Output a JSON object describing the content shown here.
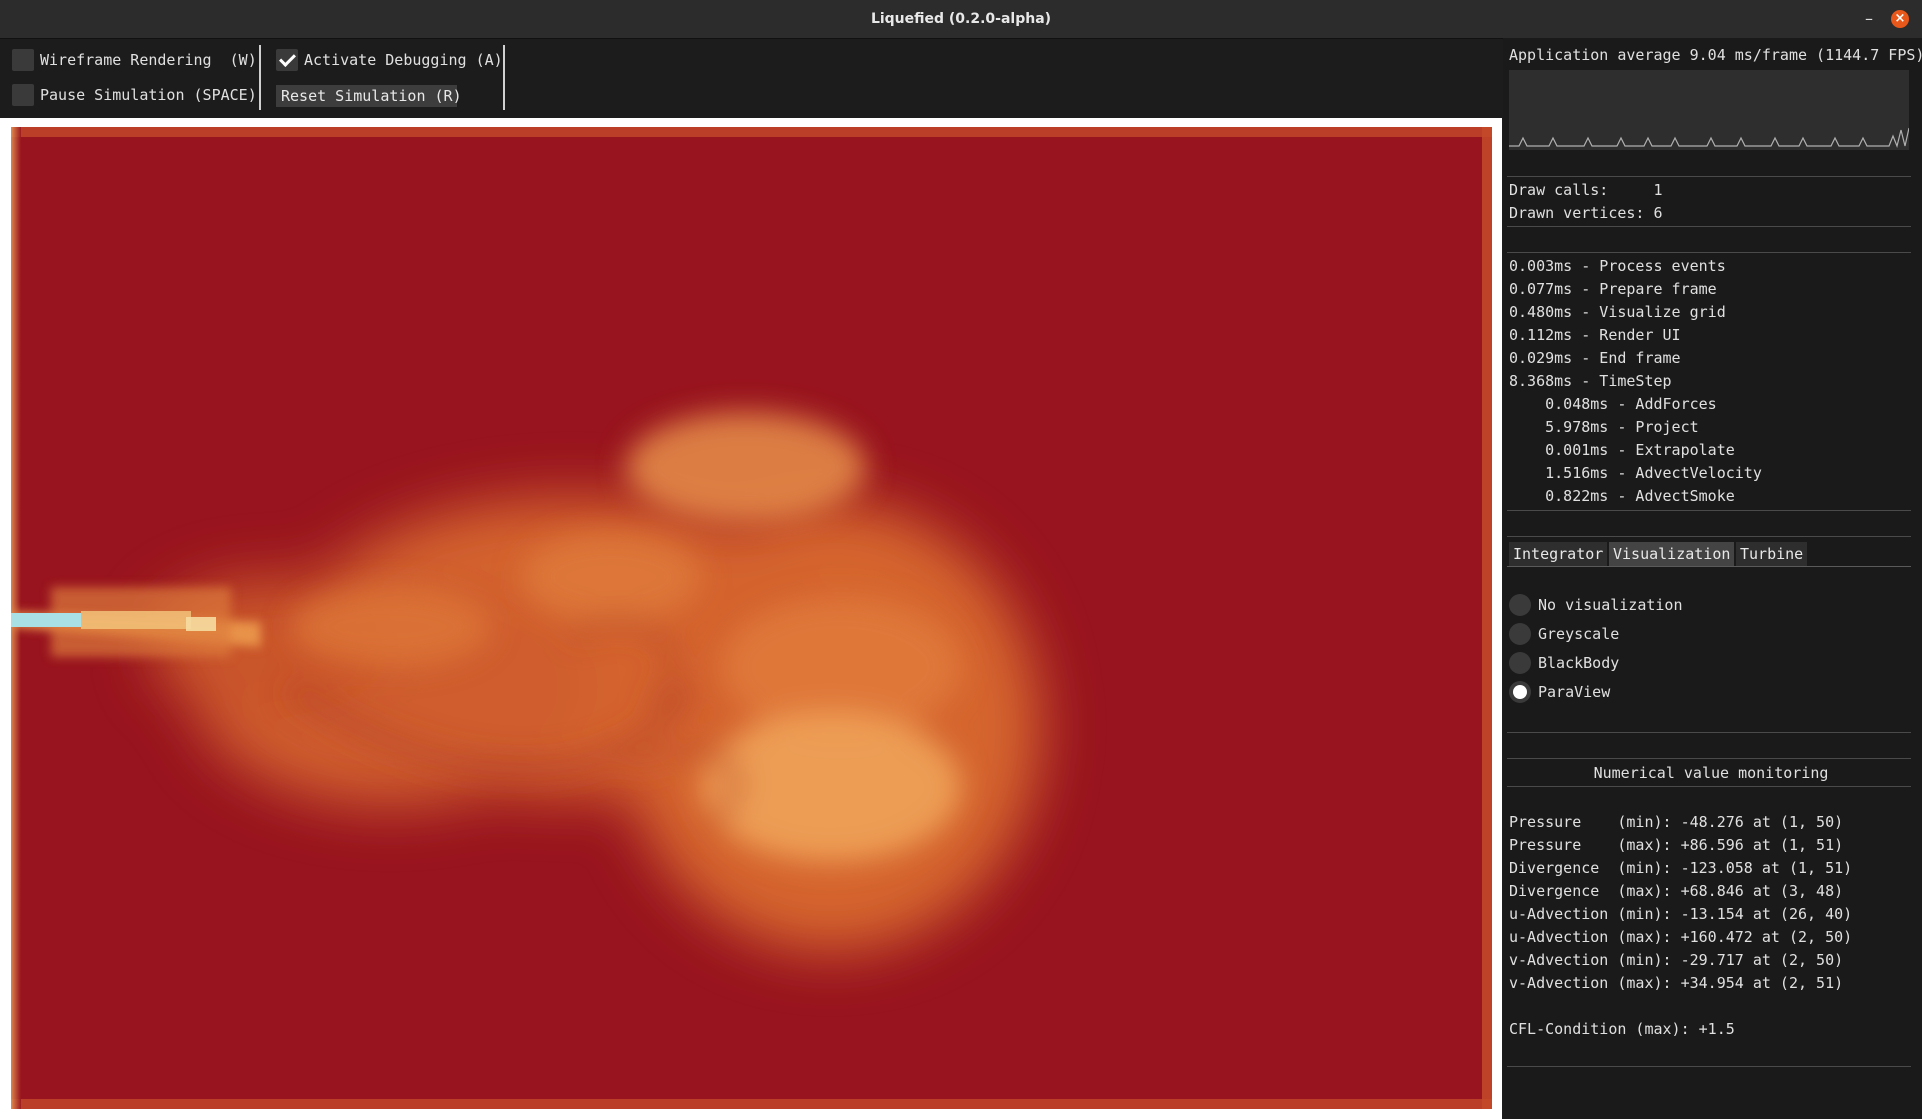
{
  "window": {
    "title": "Liquefied (0.2.0-alpha)",
    "minimize_glyph": "–",
    "close_glyph": "×"
  },
  "toolbar": {
    "wireframe_label": "Wireframe Rendering  (W)",
    "wireframe_checked": false,
    "pause_label": "Pause Simulation (SPACE)",
    "pause_checked": false,
    "debug_label": "Activate Debugging (A)",
    "debug_checked": true,
    "reset_label": "Reset Simulation (R)"
  },
  "stats": {
    "app_average": "Application average 9.04 ms/frame (1144.7 FPS)",
    "draw_calls": "Draw calls:     1",
    "drawn_vertices": "Drawn vertices: 6"
  },
  "timings": [
    "0.003ms - Process events",
    "0.077ms - Prepare frame",
    "0.480ms - Visualize grid",
    "0.112ms - Render UI",
    "0.029ms - End frame",
    "8.368ms - TimeStep",
    "    0.048ms - AddForces",
    "    5.978ms - Project",
    "    0.001ms - Extrapolate",
    "    1.516ms - AdvectVelocity",
    "    0.822ms - AdvectSmoke"
  ],
  "tabs": [
    {
      "label": "Integrator",
      "active": false
    },
    {
      "label": "Visualization",
      "active": true
    },
    {
      "label": "Turbine",
      "active": false
    }
  ],
  "visualization_options": [
    {
      "label": "No visualization",
      "selected": false
    },
    {
      "label": "Greyscale",
      "selected": false
    },
    {
      "label": "BlackBody",
      "selected": false
    },
    {
      "label": "ParaView",
      "selected": true
    }
  ],
  "monitoring": {
    "title": "Numerical value monitoring",
    "rows": [
      "Pressure    (min): -48.276 at (1, 50)",
      "Pressure    (max): +86.596 at (1, 51)",
      "Divergence  (min): -123.058 at (1, 51)",
      "Divergence  (max): +68.846 at (3, 48)",
      "u-Advection (min): -13.154 at (26, 40)",
      "u-Advection (max): +160.472 at (2, 50)",
      "v-Advection (min): -29.717 at (2, 50)",
      "v-Advection (max): +34.954 at (2, 51)"
    ],
    "cfl": "CFL-Condition (max): +1.5"
  },
  "colors": {
    "sim_background": "#98141e",
    "smoke_mid": "#d9692e",
    "smoke_bright": "#efa55a",
    "inflow": "#a9e0e6",
    "accent_close": "#e9581b"
  }
}
